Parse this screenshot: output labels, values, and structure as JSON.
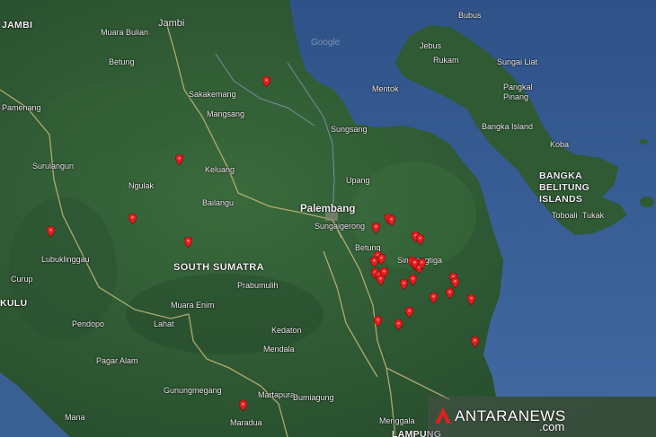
{
  "map": {
    "colors": {
      "land": "#2f5a33",
      "sea": "#3a5f93",
      "rivers": "#c6b87a",
      "pins": "#e02020"
    },
    "labels": {
      "jambi_edge": "JAMBI",
      "jambi": "Jambi",
      "muara_bulian": "Muara Bulian",
      "betung_n": "Betung",
      "pamenang": "Pamenang",
      "sakakemang": "Sakakemang",
      "mangsang": "Mangsang",
      "sungsang": "Sungsang",
      "surulangun": "Surulangun",
      "keluang": "Keluang",
      "ngulak": "Ngulak",
      "upang": "Upang",
      "bailangu": "Bailangu",
      "palembang": "Palembang",
      "sungaigerong": "Sungaigerong",
      "betung": "Betung",
      "simpangtiga": "Simpangtiga",
      "lubuklinggau": "Lubuklinggau",
      "south_sumatra": "SOUTH SUMATRA",
      "curup": "Curup",
      "prabumulih": "Prabumulih",
      "kulu": "KULU",
      "muara_enim": "Muara Enim",
      "pendopo": "Pendopo",
      "lahat": "Lahat",
      "kedaton": "Kedaton",
      "mendala": "Mendala",
      "pagar_alam": "Pagar Alam",
      "gunungmegang": "Gunungmegang",
      "martapura": "Martapura",
      "bumiagung": "Bumiagung",
      "manna": "Mana",
      "maradua": "Maradua",
      "menggala": "Menggala",
      "lampung": "LAMPUNG",
      "bubus": "Bubus",
      "jebus": "Jebus",
      "rukam": "Rukam",
      "mentok": "Mentok",
      "sungai_liat": "Sungai Liat",
      "pangkal_pinang": "Pangkal\nPinang",
      "bangka_island": "Bangka Island",
      "koba": "Koba",
      "bangka_belitung": "BANGKA\nBELITUNG\nISLANDS",
      "toboali": "Toboali",
      "tukak": "Tukak"
    },
    "hotspot_count": 34
  },
  "watermark": {
    "brand": "ANTARANEWS",
    "tld": ".com"
  }
}
